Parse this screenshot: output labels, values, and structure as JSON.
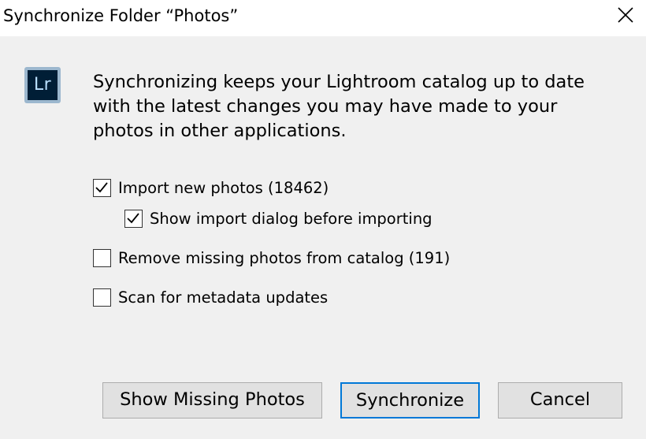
{
  "window": {
    "title": "Synchronize Folder “Photos”"
  },
  "icons": {
    "close": "close-icon",
    "app_logo": "lightroom-logo",
    "check": "checkmark-icon"
  },
  "logo": {
    "text": "Lr",
    "colors": {
      "background": "#001e36",
      "frame": "#9cb7ce",
      "text": "#b9dfff"
    }
  },
  "message": "Synchronizing keeps your Lightroom catalog up to date with the latest changes you may have made to your photos in other applications.",
  "options": {
    "import_new": {
      "label": "Import new photos (18462)",
      "checked": true
    },
    "show_import_dialog": {
      "label": "Show import dialog before importing",
      "checked": true
    },
    "remove_missing": {
      "label": "Remove missing photos from catalog (191)",
      "checked": false
    },
    "scan_metadata": {
      "label": "Scan for metadata updates",
      "checked": false
    }
  },
  "buttons": {
    "show_missing": "Show Missing Photos",
    "synchronize": "Synchronize",
    "cancel": "Cancel"
  },
  "colors": {
    "dialog_background": "#f0f0f0",
    "titlebar": "#ffffff",
    "default_button_border": "#0078d7",
    "button_background": "#e1e1e1"
  }
}
